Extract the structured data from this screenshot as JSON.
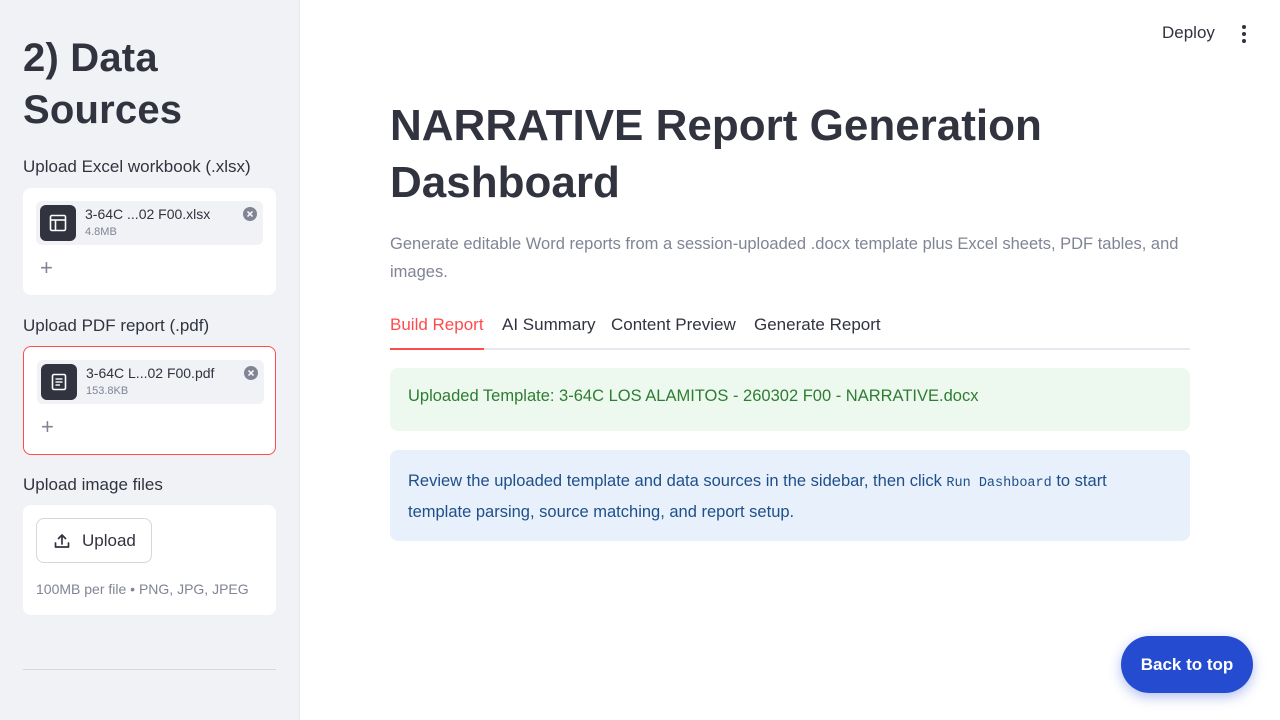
{
  "sidebar": {
    "title": "2) Data Sources",
    "excel": {
      "label": "Upload Excel workbook (.xlsx)",
      "file_name": "3-64C ...02 F00.xlsx",
      "file_size": "4.8MB",
      "icon": "spreadsheet-icon"
    },
    "pdf": {
      "label": "Upload PDF report (.pdf)",
      "file_name": "3-64C L...02 F00.pdf",
      "file_size": "153.8KB",
      "icon": "document-icon"
    },
    "images": {
      "label": "Upload image files",
      "button_label": "Upload",
      "hint": "100MB per file • PNG, JPG, JPEG"
    },
    "add_more_symbol": "+"
  },
  "header": {
    "deploy_label": "Deploy"
  },
  "main": {
    "title": "NARRATIVE Report Generation Dashboard",
    "caption": "Generate editable Word reports from a session-uploaded .docx template plus Excel sheets, PDF tables, and images.",
    "tabs": [
      {
        "label": "Build Report",
        "active": true
      },
      {
        "label": "AI Summary",
        "active": false
      },
      {
        "label": "Content Preview",
        "active": false
      },
      {
        "label": "Generate Report",
        "active": false
      }
    ],
    "success_message": "Uploaded Template: 3-64C LOS ALAMITOS - 260302 F00 - NARRATIVE.docx",
    "info_message": {
      "before": "Review the uploaded template and data sources in the sidebar, then click ",
      "code": "Run Dashboard",
      "after": " to start template parsing, source matching, and report setup."
    }
  },
  "back_to_top_label": "Back to top",
  "colors": {
    "accent": "#ff4b4b",
    "success_bg": "#edf8ef",
    "info_bg": "#e8f0fb",
    "back_to_top": "#254bd0"
  }
}
